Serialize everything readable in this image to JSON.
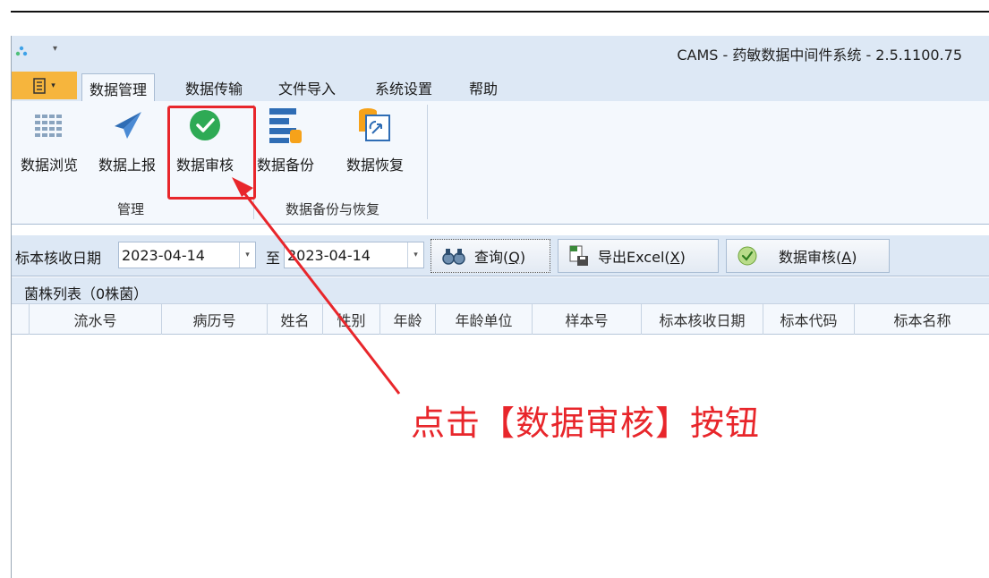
{
  "window": {
    "title": "CAMS - 药敏数据中间件系统 - 2.5.1100.75"
  },
  "tabs": [
    {
      "label": "数据管理",
      "active": true
    },
    {
      "label": "数据传输",
      "active": false
    },
    {
      "label": "文件导入",
      "active": false
    },
    {
      "label": "系统设置",
      "active": false
    },
    {
      "label": "帮助",
      "active": false
    }
  ],
  "ribbon": {
    "buttons": [
      {
        "label": "数据浏览",
        "icon": "grid-icon"
      },
      {
        "label": "数据上报",
        "icon": "paper-plane-icon"
      },
      {
        "label": "数据审核",
        "icon": "check-circle-icon"
      },
      {
        "label": "数据备份",
        "icon": "backup-icon"
      },
      {
        "label": "数据恢复",
        "icon": "restore-icon"
      }
    ],
    "groups": [
      {
        "label": "管理"
      },
      {
        "label": "数据备份与恢复"
      }
    ]
  },
  "query": {
    "date_label": "标本核收日期",
    "date_from": "2023-04-14",
    "to_label": "至",
    "date_to": "2023-04-14",
    "search_label": "查询(",
    "search_key": "Q",
    "export_label": "导出Excel(",
    "export_key": "X",
    "audit_label": "数据审核(",
    "audit_key": "A",
    "close_paren": ")"
  },
  "grid": {
    "title": "菌株列表（0株菌）",
    "columns": [
      "流水号",
      "病历号",
      "姓名",
      "性别",
      "年龄",
      "年龄单位",
      "样本号",
      "标本核收日期",
      "标本代码",
      "标本名称"
    ]
  },
  "annotation": {
    "text": "点击【数据审核】按钮",
    "color": "#e8262b"
  },
  "colors": {
    "ribbon_bg": "#f4f8fd",
    "chrome_bg": "#dde8f5",
    "file_button": "#f6b53d",
    "accent_green": "#2eaa55"
  }
}
